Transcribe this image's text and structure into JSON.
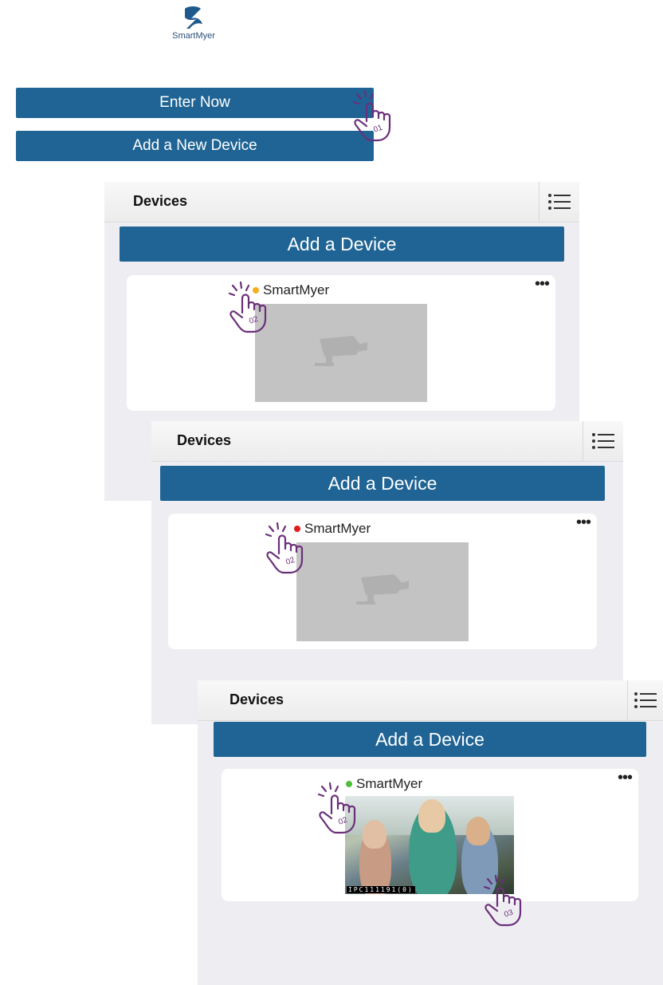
{
  "logo": {
    "name": "SmartMyer"
  },
  "login": {
    "enter_label": "Enter Now",
    "add_new_label": "Add a New Device"
  },
  "screens": [
    {
      "title": "Devices",
      "add_label": "Add a Device",
      "device_name": "SmartMyer",
      "status_color": "#f2b01e",
      "more": "•••",
      "step": "02"
    },
    {
      "title": "Devices",
      "add_label": "Add a Device",
      "device_name": "SmartMyer",
      "status_color": "#e21b1b",
      "more": "•••",
      "step": "02"
    },
    {
      "title": "Devices",
      "add_label": "Add a Device",
      "device_name": "SmartMyer",
      "status_color": "#4fbf3b",
      "more": "•••",
      "step": "02",
      "camera_label": "IPC111191(0)"
    }
  ],
  "steps": {
    "enter": "01",
    "play": "03"
  },
  "colors": {
    "primary": "#1f6494",
    "hand": "#6b2f7a",
    "panel_bg": "#eeeef2"
  }
}
